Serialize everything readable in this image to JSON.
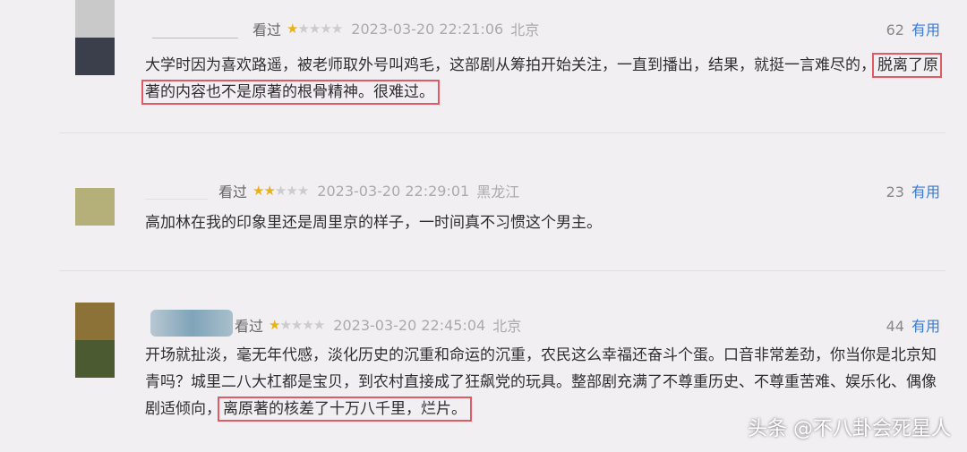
{
  "reviews": [
    {
      "seen": "看过",
      "rating": 1,
      "time": "2023-03-20 22:21:06",
      "location": "北京",
      "votes": "62",
      "useful": "有用",
      "text_plain": "大学时因为喜欢路遥，被老师取外号叫鸡毛，这部剧从筹拍开始关注，一直到播出，结果，就挺一言难尽的，",
      "text_highlight": "脱离了原著的内容也不是原著的根骨精神。很难过。",
      "text_after": ""
    },
    {
      "seen": "看过",
      "rating": 2,
      "time": "2023-03-20 22:29:01",
      "location": "黑龙江",
      "votes": "23",
      "useful": "有用",
      "text_plain": "高加林在我的印象里还是周里京的样子，一时间真不习惯这个男主。",
      "text_highlight": "",
      "text_after": ""
    },
    {
      "seen": "看过",
      "rating": 1,
      "time": "2023-03-20 22:45:04",
      "location": "北京",
      "votes": "44",
      "useful": "有用",
      "text_plain": "开场就扯淡，毫无年代感，淡化历史的沉重和命运的沉重，农民这么幸福还奋斗个蛋。口音非常差劲，你当你是北京知青吗？城里二八大杠都是宝贝，到农村直接成了狂飙党的玩具。整部剧充满了不尊重历史、不尊重苦难、娱乐化、偶像剧适倾向，",
      "text_highlight": "离原著的核差了十万八千里，烂片。",
      "text_after": ""
    }
  ],
  "watermark": "头条 @不八卦会死星人",
  "colors": {
    "star_on": "#e8b21a",
    "star_off": "#cccccc",
    "useful": "#3a7bd5",
    "highlight_box": "#e05a64"
  }
}
